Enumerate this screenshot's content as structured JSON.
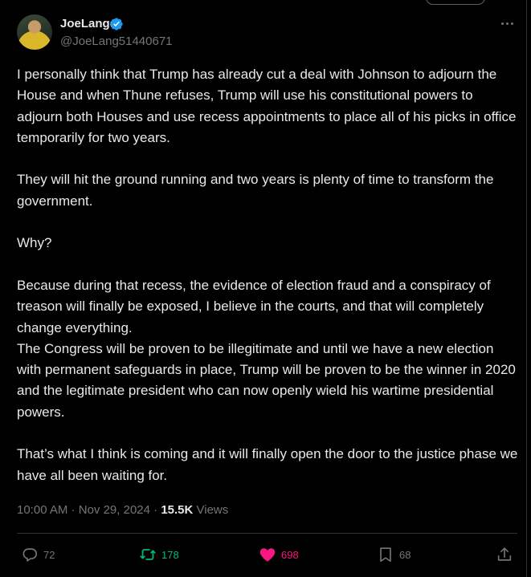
{
  "author": {
    "display_name": "JoeLange",
    "handle": "@JoeLang51440671",
    "verified": true
  },
  "tweet": {
    "paragraphs": [
      "I personally think that Trump has already cut a deal with Johnson to adjourn the House and when Thune refuses, Trump will use his constitutional powers to adjourn both Houses and use recess appointments to place all of his picks in office temporarily for two years.",
      "",
      "They will hit the ground running and two years is plenty of time to transform the government.",
      "",
      "Why?",
      "",
      "Because during that recess, the evidence of election fraud and a conspiracy of treason will finally be exposed, I believe in the courts, and that will completely change everything.",
      "The Congress will be proven to be illegitimate and until we have a new election with permanent safeguards in place, Trump will be proven to be the winner in 2020 and the legitimate president who can now openly wield his wartime presidential powers.",
      "",
      "That’s what I think is coming and it will finally open the door to the justice phase we have all been waiting for."
    ]
  },
  "meta": {
    "time": "10:00 AM",
    "separator": " · ",
    "date": "Nov 29, 2024",
    "views_count": "15.5K",
    "views_label": "Views"
  },
  "actions": {
    "replies": "72",
    "retweets": "178",
    "likes": "698",
    "bookmarks": "68"
  },
  "colors": {
    "background": "#000000",
    "text": "#e7e9ea",
    "secondary": "#71767b",
    "verified": "#1d9bf0",
    "retweet": "#00ba7c",
    "like": "#f91880"
  },
  "icons": [
    "verified-badge-icon",
    "more-icon",
    "reply-icon",
    "retweet-icon",
    "heart-icon",
    "bookmark-icon",
    "share-icon"
  ]
}
